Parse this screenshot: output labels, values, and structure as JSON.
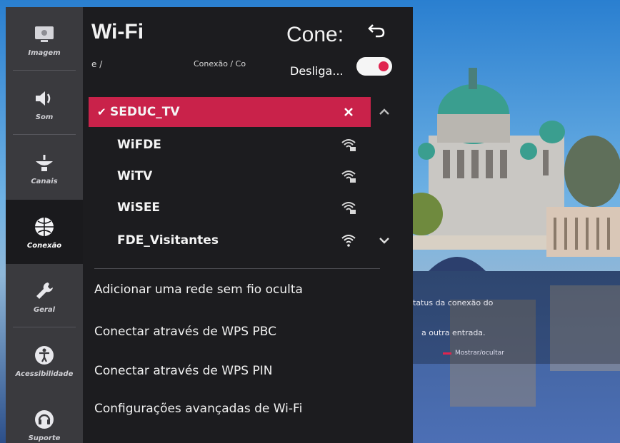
{
  "rail": {
    "items": [
      {
        "label": "Imagem",
        "icon": "picture-icon"
      },
      {
        "label": "Som",
        "icon": "speaker-icon"
      },
      {
        "label": "Canais",
        "icon": "antenna-icon"
      },
      {
        "label": "Conexão",
        "icon": "globe-icon"
      },
      {
        "label": "Geral",
        "icon": "wrench-icon"
      },
      {
        "label": "Acessibilidade",
        "icon": "accessibility-icon"
      },
      {
        "label": "Suporte",
        "icon": "support-icon"
      }
    ],
    "active_index": 3
  },
  "panel": {
    "title": "Wi-Fi",
    "breadcrumb_left": "e /",
    "breadcrumb_mid": "Conexão / Co",
    "secondary_title": "Cone:",
    "toggle_label": "Desliga...",
    "toggle_state": "on"
  },
  "networks": [
    {
      "name": "SEDUC_TV",
      "selected": true,
      "status_icon": "close-icon"
    },
    {
      "name": "WiFDE",
      "selected": false,
      "status_icon": "wifi-lock-icon"
    },
    {
      "name": "WiTV",
      "selected": false,
      "status_icon": "wifi-lock-icon"
    },
    {
      "name": "WiSEE",
      "selected": false,
      "status_icon": "wifi-lock-icon"
    },
    {
      "name": "FDE_Visitantes",
      "selected": false,
      "status_icon": "wifi-icon"
    }
  ],
  "actions": [
    {
      "label": "Adicionar uma rede sem fio oculta"
    },
    {
      "label": "Conectar através de WPS PBC"
    },
    {
      "label": "Conectar através de WPS PIN"
    },
    {
      "label": "Configurações avançadas de Wi-Fi"
    }
  ],
  "background_dialog": {
    "line1": "tatus da conexão do",
    "line2": "a outra entrada.",
    "toggle_text": "Mostrar/ocultar"
  },
  "colors": {
    "accent": "#c9224a",
    "panel_bg": "#1c1c1f",
    "rail_bg": "#3a3a3e"
  }
}
